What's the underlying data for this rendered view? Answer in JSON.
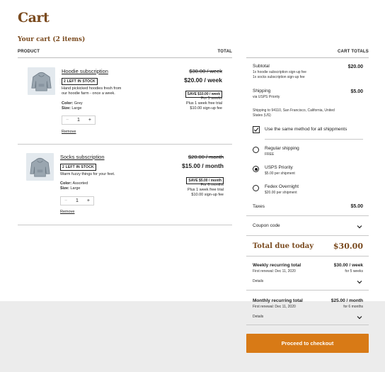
{
  "page_title": "Cart",
  "section_title": "Your cart (2 items)",
  "columns": {
    "product": "PRODUCT",
    "total": "TOTAL",
    "cart_totals": "CART TOTALS"
  },
  "items": [
    {
      "name": "Hoodie subscription",
      "stock": "2 LEFT IN STOCK",
      "desc": [
        "Hand pickicked hoodies fresh from",
        "our hoodie farm - once a week."
      ],
      "color_label": "Color:",
      "color_value": "Grey",
      "size_label": "Size:",
      "size_value": "Large",
      "quantity": "1",
      "remove": "Remove",
      "old_price": "$30.00 / week",
      "new_price": "$20.00 / week",
      "save": "SAVE $10.00 / week",
      "fine": [
        "For 5 weeks",
        "Plus 1 week free trial",
        "$10.00 sign-up fee"
      ]
    },
    {
      "name": "Socks subscription",
      "stock": "2 LEFT IN STOCK",
      "desc": [
        "Warm fuzzy things for your feet."
      ],
      "color_label": "Color:",
      "color_value": "Assorted",
      "size_label": "Size:",
      "size_value": "Large",
      "quantity": "1",
      "remove": "Remove",
      "old_price": "$20.00 / month",
      "new_price": "$15.00 / month",
      "save": "SAVE $5.00 / month",
      "fine": [
        "For 6 months",
        "Plus 1 week free trial",
        "$10.00 sign-up fee"
      ]
    }
  ],
  "totals": {
    "subtotal_label": "Subtotal",
    "subtotal_amount": "$20.00",
    "subtotal_notes": [
      "1x hoodie subscription sign-up fee",
      "1x socks subscription sign-up fee"
    ],
    "shipping_label": "Shipping",
    "shipping_amount": "$5.00",
    "shipping_via": "via USPS Priority",
    "shipping_to": [
      "Shipping to 94110, San Francisco, California, United",
      "States (US)"
    ],
    "same_method": "Use the same method for all shippments",
    "options": [
      {
        "label": "Regular shipping",
        "sub": "FREE",
        "selected": false
      },
      {
        "label": "USPS Priority",
        "sub": "$5.00 per shipment",
        "selected": true
      },
      {
        "label": "Fedex Overnight",
        "sub": "$20.00 per shipment",
        "selected": false
      }
    ],
    "taxes_label": "Taxes",
    "taxes_amount": "$5.00",
    "coupon_label": "Coupon code",
    "total_label": "Total due today",
    "total_amount": "$30.00",
    "weekly_label": "Weekly recurring total",
    "weekly_amount": "$30.00 / week",
    "weekly_renewal": "First renewal: Dec 11, 2020",
    "weekly_duration": "for 5 weeks",
    "weekly_details": "Details",
    "monthly_label": "Monthly recurring total",
    "monthly_amount": "$25.00 / month",
    "monthly_renewal": "First renewal: Dec 11, 2020",
    "monthly_duration": "for 6 months",
    "monthly_details": "Details",
    "checkout": "Proceed to checkout"
  },
  "colors": {
    "brand": "#7a4a1e",
    "accent": "#d87a16"
  },
  "icons": {
    "thumbnail": "hoodie-icon",
    "chevron": "chevron-down-icon",
    "check": "checkmark-icon"
  }
}
